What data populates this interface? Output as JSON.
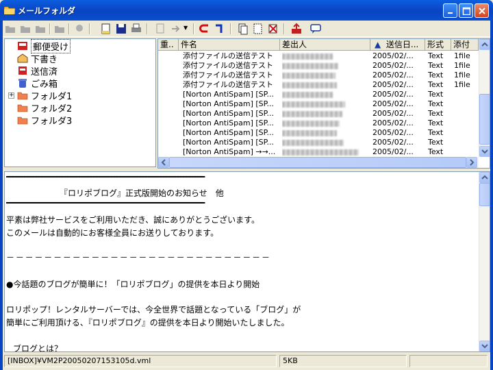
{
  "window": {
    "title": "メールフォルダ"
  },
  "folders": [
    {
      "label": "郵便受け",
      "icon": "inbox-icon",
      "selected": true
    },
    {
      "label": "下書き",
      "icon": "draft-icon"
    },
    {
      "label": "送信済",
      "icon": "sent-icon"
    },
    {
      "label": "ごみ箱",
      "icon": "trash-icon"
    },
    {
      "label": "フォルダ1",
      "icon": "folder-icon",
      "expandable": true
    },
    {
      "label": "フォルダ2",
      "icon": "folder-icon"
    },
    {
      "label": "フォルダ3",
      "icon": "folder-icon"
    }
  ],
  "list": {
    "columns": [
      "重..",
      "件名",
      "差出人",
      "送信日...",
      "形式",
      "添付"
    ],
    "sort_indicator": "▲",
    "rows": [
      {
        "subject": "添付ファイルの送信テスト",
        "date": "2005/02/...",
        "format": "Text",
        "attach": "1file"
      },
      {
        "subject": "添付ファイルの送信テスト",
        "date": "2005/02/...",
        "format": "Text",
        "attach": "1file"
      },
      {
        "subject": "添付ファイルの送信テスト",
        "date": "2005/02/...",
        "format": "Text",
        "attach": "1file"
      },
      {
        "subject": "添付ファイルの送信テスト",
        "date": "2005/02/...",
        "format": "Text",
        "attach": "1file"
      },
      {
        "subject": "[Norton AntiSpam] [SP...",
        "date": "2005/02/...",
        "format": "Text",
        "attach": ""
      },
      {
        "subject": "[Norton AntiSpam] [SP...",
        "date": "2005/02/...",
        "format": "Text",
        "attach": ""
      },
      {
        "subject": "[Norton AntiSpam] [SP...",
        "date": "2005/02/...",
        "format": "Text",
        "attach": ""
      },
      {
        "subject": "[Norton AntiSpam] [SP...",
        "date": "2005/02/...",
        "format": "Text",
        "attach": ""
      },
      {
        "subject": "[Norton AntiSpam] [SP...",
        "date": "2005/02/...",
        "format": "Text",
        "attach": ""
      },
      {
        "subject": "[Norton AntiSpam] [SP...",
        "date": "2005/02/...",
        "format": "Text",
        "attach": ""
      },
      {
        "subject": "[Norton AntiSpam] →→...",
        "date": "2005/02/...",
        "format": "Text",
        "attach": ""
      }
    ]
  },
  "preview": {
    "rule1": "━━━━━━━━━━━━━━━━━━━━━━━━━━━━━━━━━━━━━━━━━━━━━━━━━━━━━━━━━━━━━━━━━━━━",
    "heading": "『ロリポブログ』正式版開始のお知らせ　他",
    "rule2": "━━━━━━━━━━━━━━━━━━━━━━━━━━━━━━━━━━━━━━━━━━━━━━━━━━━━━━━━━━━━━━━━━━━━",
    "p1": "平素は弊社サービスをご利用いただき、誠にありがとうございます。",
    "p2": "このメールは自動的にお客様全員にお送りしております。",
    "dashes": "－ － － － － － － － － － － － － － － － － － － － － － － － － － － －",
    "bullet": "●今話題のブログが簡単に！「ロリポブログ」の提供を本日より開始",
    "p3": "ロリポップ！レンタルサーバーでは、今全世界で話題となっている「ブログ」が",
    "p4": "簡単にご利用頂ける、『ロリポブログ』の提供を本日より開始いたしました。",
    "p5": "ブログとは？"
  },
  "status": {
    "path": "[INBOX]¥VM2P20050207153105d.vml",
    "size": "5KB"
  },
  "colors": {
    "titlebar": "#0a4fd0",
    "accent": "#7f9db9"
  }
}
